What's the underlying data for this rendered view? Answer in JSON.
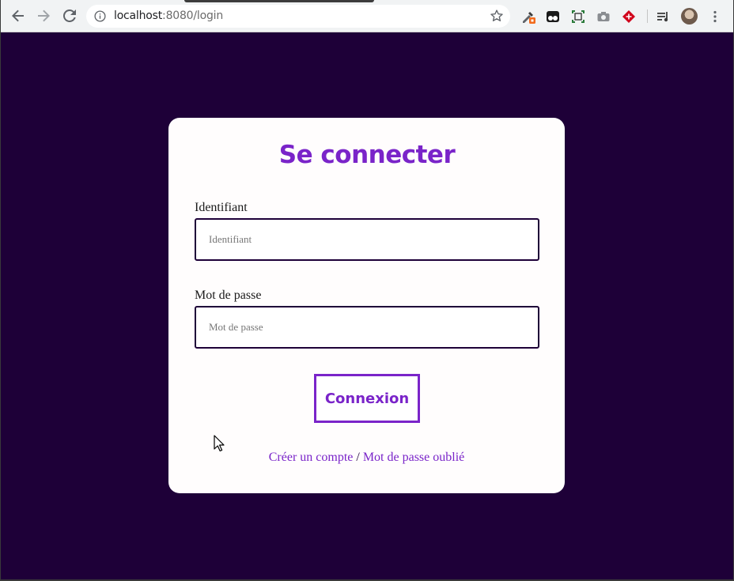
{
  "browser": {
    "url_host": "localhost",
    "url_rest": ":8080/login",
    "icons": {
      "back": "arrow-left-icon",
      "forward": "arrow-right-icon",
      "reload": "reload-icon",
      "site_info": "info-circle-icon",
      "bookmark": "star-icon",
      "menu": "kebab-menu-icon"
    },
    "extensions": [
      "eyedropper-extension-icon",
      "tampermonkey-icon",
      "screenshot-crop-icon",
      "camera-icon",
      "red-diamond-extension-icon",
      "media-queue-icon"
    ]
  },
  "page": {
    "background_color": "#1e0038",
    "accent_color": "#7a24c9",
    "title": "Se connecter",
    "username": {
      "label": "Identifiant",
      "placeholder": "Identifiant",
      "value": ""
    },
    "password": {
      "label": "Mot de passe",
      "placeholder": "Mot de passe",
      "value": ""
    },
    "submit_label": "Connexion",
    "links": {
      "create_account": "Créer un compte",
      "separator": "/",
      "forgot_password": "Mot de passe oublié"
    }
  }
}
